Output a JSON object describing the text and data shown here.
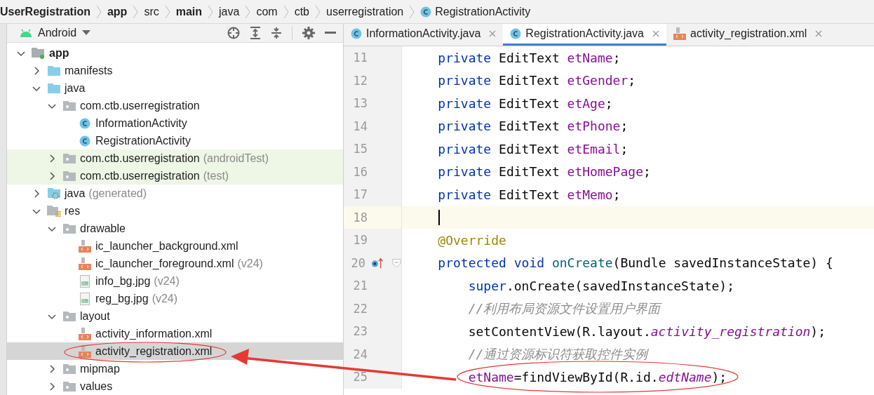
{
  "breadcrumb": [
    {
      "label": "UserRegistration",
      "bold": true,
      "kind": "plain"
    },
    {
      "label": "app",
      "bold": true,
      "kind": "plain"
    },
    {
      "label": "src",
      "bold": false,
      "kind": "plain"
    },
    {
      "label": "main",
      "bold": true,
      "kind": "plain"
    },
    {
      "label": "java",
      "bold": false,
      "kind": "plain"
    },
    {
      "label": "com",
      "bold": false,
      "kind": "plain"
    },
    {
      "label": "ctb",
      "bold": false,
      "kind": "plain"
    },
    {
      "label": "userregistration",
      "bold": false,
      "kind": "plain"
    },
    {
      "label": "RegistrationActivity",
      "bold": false,
      "kind": "class"
    }
  ],
  "project_panel": {
    "view": "Android",
    "tree": [
      {
        "label": "app",
        "bold": true,
        "kind": "module",
        "expanded": true,
        "selected": false,
        "highlighted": false,
        "children": [
          {
            "label": "manifests",
            "kind": "folder",
            "expanded": false,
            "selected": false,
            "highlighted": false
          },
          {
            "label": "java",
            "kind": "folder",
            "expanded": true,
            "selected": false,
            "highlighted": false,
            "children": [
              {
                "label": "com.ctb.userregistration",
                "kind": "package",
                "expanded": true,
                "selected": false,
                "highlighted": false,
                "children": [
                  {
                    "label": "InformationActivity",
                    "kind": "class",
                    "selected": false,
                    "highlighted": false
                  },
                  {
                    "label": "RegistrationActivity",
                    "kind": "class",
                    "selected": false,
                    "highlighted": false
                  }
                ]
              },
              {
                "label": "com.ctb.userregistration",
                "suffix": "(androidTest)",
                "kind": "package",
                "expanded": false,
                "selected": false,
                "highlighted": true
              },
              {
                "label": "com.ctb.userregistration",
                "suffix": "(test)",
                "kind": "package",
                "expanded": false,
                "selected": false,
                "highlighted": true
              }
            ]
          },
          {
            "label": "java",
            "suffix": "(generated)",
            "kind": "generated",
            "expanded": false,
            "selected": false,
            "highlighted": false
          },
          {
            "label": "res",
            "kind": "res",
            "expanded": true,
            "selected": false,
            "highlighted": false,
            "children": [
              {
                "label": "drawable",
                "kind": "package",
                "expanded": true,
                "selected": false,
                "highlighted": false,
                "children": [
                  {
                    "label": "ic_launcher_background.xml",
                    "kind": "xml",
                    "selected": false,
                    "highlighted": false
                  },
                  {
                    "label": "ic_launcher_foreground.xml",
                    "suffix": "(v24)",
                    "kind": "xml",
                    "selected": false,
                    "highlighted": false
                  },
                  {
                    "label": "info_bg.jpg",
                    "suffix": "(v24)",
                    "kind": "image",
                    "selected": false,
                    "highlighted": false
                  },
                  {
                    "label": "reg_bg.jpg",
                    "suffix": "(v24)",
                    "kind": "image",
                    "selected": false,
                    "highlighted": false
                  }
                ]
              },
              {
                "label": "layout",
                "kind": "package",
                "expanded": true,
                "selected": false,
                "highlighted": false,
                "children": [
                  {
                    "label": "activity_information.xml",
                    "kind": "xml",
                    "selected": false,
                    "highlighted": false
                  },
                  {
                    "label": "activity_registration.xml",
                    "kind": "xml",
                    "selected": true,
                    "highlighted": false
                  }
                ]
              },
              {
                "label": "mipmap",
                "kind": "package",
                "expanded": false,
                "selected": false,
                "highlighted": false
              },
              {
                "label": "values",
                "kind": "package",
                "expanded": false,
                "selected": false,
                "highlighted": false
              }
            ]
          }
        ]
      }
    ]
  },
  "editor": {
    "tabs": [
      {
        "label": "InformationActivity.java",
        "kind": "class",
        "selected": false
      },
      {
        "label": "RegistrationActivity.java",
        "kind": "class",
        "selected": true
      },
      {
        "label": "activity_registration.xml",
        "kind": "xml",
        "selected": false
      }
    ],
    "lines": [
      {
        "number": "11",
        "current": false,
        "kind": "code",
        "tokens": [
          {
            "kind": "keyword",
            "text": "    private "
          },
          {
            "kind": "plain",
            "text": "EditText "
          },
          {
            "kind": "field",
            "text": "etName"
          },
          {
            "kind": "plain",
            "text": ";"
          }
        ]
      },
      {
        "number": "12",
        "current": false,
        "kind": "code",
        "tokens": [
          {
            "kind": "keyword",
            "text": "    private "
          },
          {
            "kind": "plain",
            "text": "EditText "
          },
          {
            "kind": "field",
            "text": "etGender"
          },
          {
            "kind": "plain",
            "text": ";"
          }
        ]
      },
      {
        "number": "13",
        "current": false,
        "kind": "code",
        "tokens": [
          {
            "kind": "keyword",
            "text": "    private "
          },
          {
            "kind": "plain",
            "text": "EditText "
          },
          {
            "kind": "field",
            "text": "etAge"
          },
          {
            "kind": "plain",
            "text": ";"
          }
        ]
      },
      {
        "number": "14",
        "current": false,
        "kind": "code",
        "tokens": [
          {
            "kind": "keyword",
            "text": "    private "
          },
          {
            "kind": "plain",
            "text": "EditText "
          },
          {
            "kind": "field",
            "text": "etPhone"
          },
          {
            "kind": "plain",
            "text": ";"
          }
        ]
      },
      {
        "number": "15",
        "current": false,
        "kind": "code",
        "tokens": [
          {
            "kind": "keyword",
            "text": "    private "
          },
          {
            "kind": "plain",
            "text": "EditText "
          },
          {
            "kind": "field",
            "text": "etEmail"
          },
          {
            "kind": "plain",
            "text": ";"
          }
        ]
      },
      {
        "number": "16",
        "current": false,
        "kind": "code",
        "tokens": [
          {
            "kind": "keyword",
            "text": "    private "
          },
          {
            "kind": "plain",
            "text": "EditText "
          },
          {
            "kind": "field",
            "text": "etHomePage"
          },
          {
            "kind": "plain",
            "text": ";"
          }
        ]
      },
      {
        "number": "17",
        "current": false,
        "kind": "code",
        "tokens": [
          {
            "kind": "keyword",
            "text": "    private "
          },
          {
            "kind": "plain",
            "text": "EditText "
          },
          {
            "kind": "field",
            "text": "etMemo"
          },
          {
            "kind": "plain",
            "text": ";"
          }
        ]
      },
      {
        "number": "18",
        "current": true,
        "kind": "code"
      },
      {
        "number": "19",
        "current": false,
        "kind": "code",
        "tokens": [
          {
            "kind": "annotation",
            "text": "    @Override"
          }
        ]
      },
      {
        "number": "20",
        "current": false,
        "kind": "override",
        "tokens": [
          {
            "kind": "keyword",
            "text": "    protected void "
          },
          {
            "kind": "method",
            "text": "onCreate"
          },
          {
            "kind": "plain",
            "text": "(Bundle savedInstanceState) {"
          }
        ]
      },
      {
        "number": "21",
        "current": false,
        "kind": "code",
        "tokens": [
          {
            "kind": "keyword",
            "text": "        super"
          },
          {
            "kind": "plain",
            "text": ".onCreate(savedInstanceState);"
          }
        ]
      },
      {
        "number": "22",
        "current": false,
        "kind": "code",
        "tokens": [
          {
            "kind": "comment",
            "text": "        //利用布局资源文件设置用户界面"
          }
        ]
      },
      {
        "number": "23",
        "current": false,
        "kind": "code",
        "tokens": [
          {
            "kind": "plain",
            "text": "        setContentView(R.layout."
          },
          {
            "kind": "static",
            "text": "activity_registration"
          },
          {
            "kind": "plain",
            "text": ");"
          }
        ]
      },
      {
        "number": "24",
        "current": false,
        "kind": "code",
        "tokens": [
          {
            "kind": "comment",
            "text": "        //通过资源标识符获取控件实例"
          }
        ]
      },
      {
        "number": "25",
        "current": false,
        "kind": "code",
        "tokens": [
          {
            "kind": "field",
            "text": "        etName"
          },
          {
            "kind": "plain",
            "text": "=findViewById(R.id."
          },
          {
            "kind": "static",
            "text": "edtName"
          },
          {
            "kind": "plain",
            "text": ");"
          }
        ]
      }
    ]
  }
}
